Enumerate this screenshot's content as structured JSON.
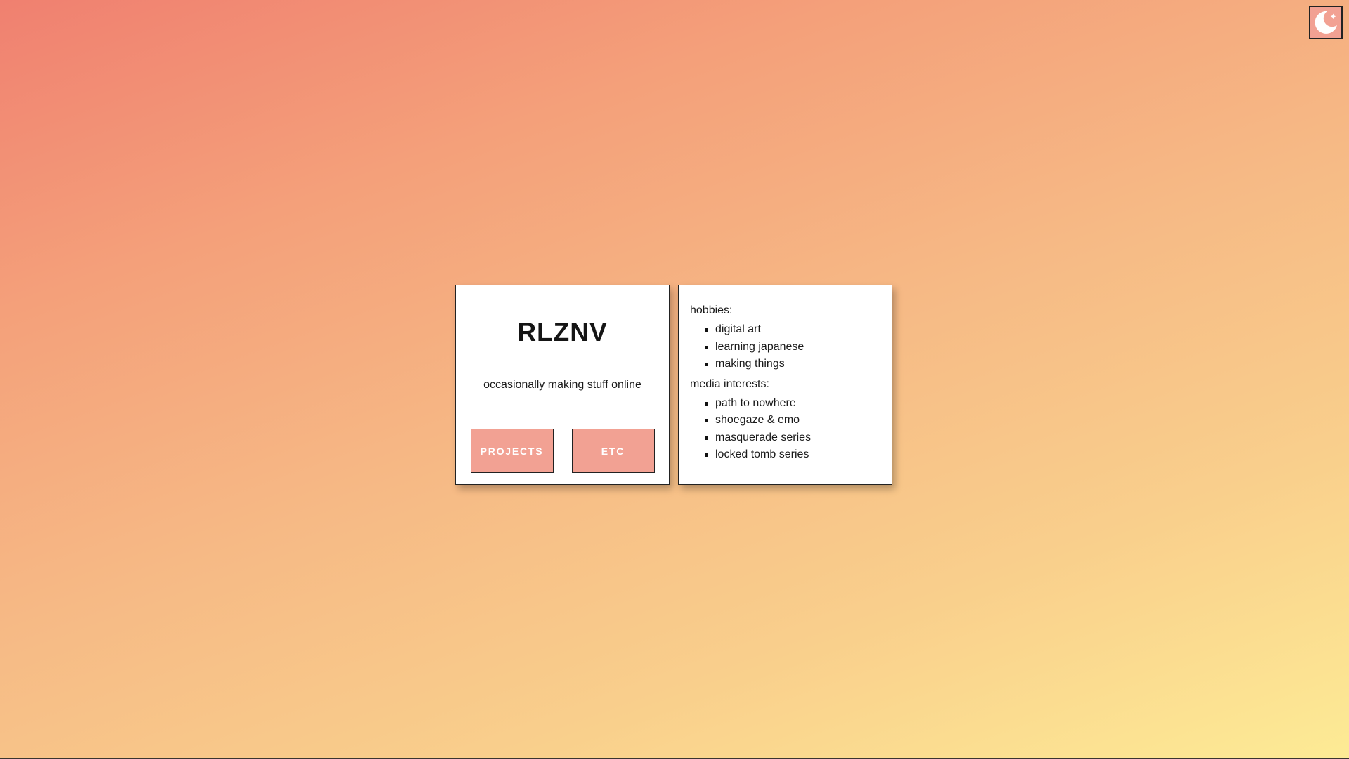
{
  "theme_toggle": {
    "icon": "moon-icon"
  },
  "profile": {
    "title": "RLZNV",
    "tagline": "occasionally making stuff online",
    "buttons": {
      "projects": "PROJECTS",
      "etc": "ETC"
    }
  },
  "info": {
    "hobbies_heading": "hobbies:",
    "hobbies": [
      "digital art",
      "learning japanese",
      "making things"
    ],
    "media_heading": "media interests:",
    "media": [
      "path to nowhere",
      "shoegaze & emo",
      "masquerade series",
      "locked tomb series"
    ]
  },
  "colors": {
    "accent": "#f2a193",
    "gradient_start": "#f08070",
    "gradient_end": "#fdeb95"
  }
}
